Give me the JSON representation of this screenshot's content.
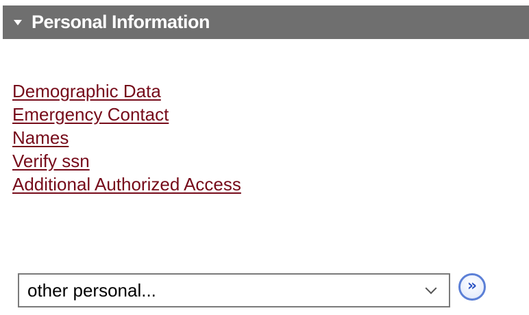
{
  "header": {
    "title": "Personal Information",
    "toggle_icon": "triangle-down-icon"
  },
  "links": [
    {
      "label": "Demographic Data"
    },
    {
      "label": "Emergency Contact"
    },
    {
      "label": "Names"
    },
    {
      "label": "Verify ssn"
    },
    {
      "label": "Additional Authorized Access"
    }
  ],
  "select": {
    "value": "other personal...",
    "icon": "chevron-down-icon"
  },
  "go_button": {
    "glyph": "»",
    "icon": "double-chevron-right-icon"
  },
  "colors": {
    "header_bg": "#6f6f6f",
    "header_text": "#ffffff",
    "link": "#760b1a",
    "go_button": "#2d55c4"
  }
}
